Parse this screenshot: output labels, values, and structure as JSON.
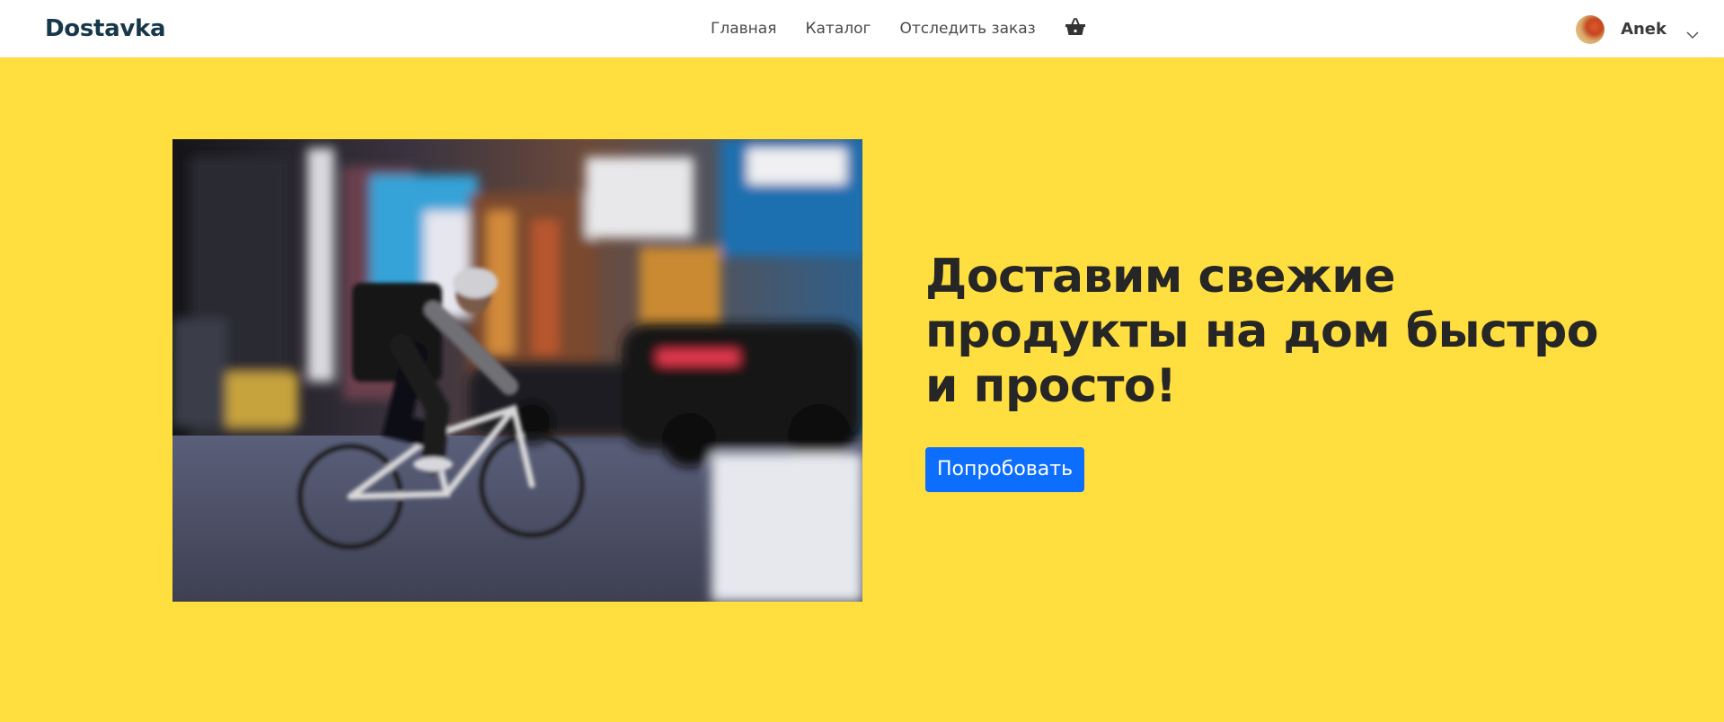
{
  "header": {
    "brand": "Dostavka",
    "nav": {
      "home": "Главная",
      "catalog": "Каталог",
      "track": "Отследить заказ"
    },
    "cart_icon": "basket-icon",
    "user": {
      "name": "Anek",
      "avatar_icon": "user-avatar",
      "menu_icon": "chevron-down-icon"
    }
  },
  "hero": {
    "title": "Доставим свежие продукты на дом быстро и просто!",
    "cta_label": "Попробовать",
    "image": "courier-on-bicycle-photo"
  },
  "colors": {
    "hero_background": "#ffde40",
    "brand_text": "#17384a",
    "cta_background": "#0d6efd",
    "title_text": "#262626"
  }
}
